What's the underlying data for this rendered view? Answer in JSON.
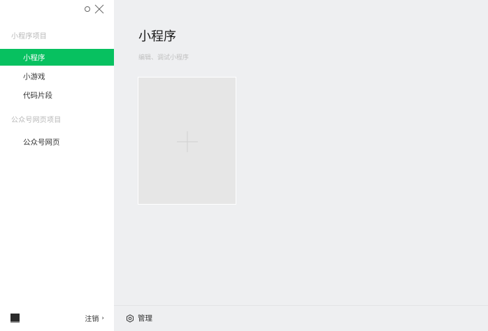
{
  "sidebar": {
    "sections": [
      {
        "title": "小程序项目",
        "items": [
          {
            "label": "小程序",
            "active": true
          },
          {
            "label": "小游戏",
            "active": false
          },
          {
            "label": "代码片段",
            "active": false
          }
        ]
      },
      {
        "title": "公众号网页项目",
        "items": [
          {
            "label": "公众号网页",
            "active": false
          }
        ]
      }
    ],
    "footer": {
      "logout_label": "注销",
      "logout_icon": "chevron-right-icon"
    }
  },
  "window_controls": {
    "minimize_icon": "circle-icon",
    "close_icon": "close-icon"
  },
  "main": {
    "title": "小程序",
    "subtitle": "编辑、调试小程序",
    "add_card_icon": "plus-icon",
    "footer": {
      "manage_label": "管理",
      "manage_icon": "gear-icon"
    }
  },
  "colors": {
    "accent": "#07c160",
    "main_bg": "#eeeff1",
    "card_bg": "#e6e6e6"
  }
}
